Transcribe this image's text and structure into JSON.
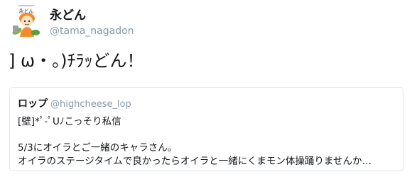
{
  "tweet": {
    "display_name": "永どん",
    "handle": "@tama_nagadon",
    "text": "] ω・。)ﾁﾗｯどん！",
    "avatar_icon": "mascot-character-avatar"
  },
  "quoted_tweet": {
    "display_name": "ロップ",
    "handle": "@highcheese_lop",
    "line1": "[壁]*ﾟ-ﾟUﾉこっそり私信",
    "line2": "5/3にオイラとご一緒のキャラさん。",
    "line3": "オイラのステージタイムで良かったらオイラと一緒にくまモン体操踊りませんか…"
  },
  "colors": {
    "text": "#14171a",
    "muted": "#8899a6",
    "border": "#e1e8ed",
    "avatar_accent": "#f08c2a"
  }
}
